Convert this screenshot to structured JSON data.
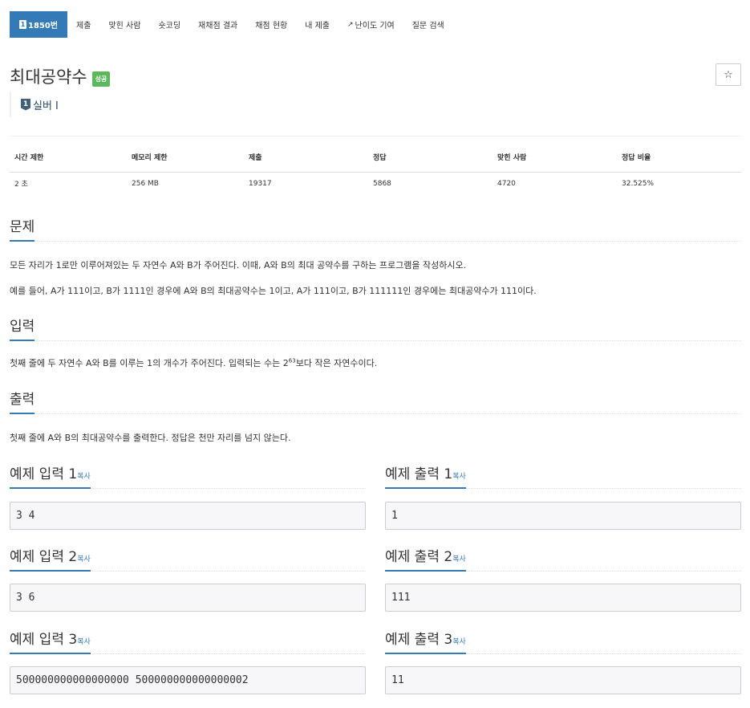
{
  "nav": {
    "problem_number": "1850번",
    "items": [
      "제출",
      "맞힌 사람",
      "숏코딩",
      "재채점 결과",
      "채점 현황",
      "내 제출",
      "난이도 기여",
      "질문 검색"
    ]
  },
  "problem": {
    "title": "최대공약수",
    "status_badge": "성공",
    "tier_label": "실버 I",
    "tier_number": "1",
    "star": "☆"
  },
  "info_table": {
    "headers": [
      "시간 제한",
      "메모리 제한",
      "제출",
      "정답",
      "맞힌 사람",
      "정답 비율"
    ],
    "values": [
      "2 초",
      "256 MB",
      "19317",
      "5868",
      "4720",
      "32.525%"
    ]
  },
  "sections": {
    "description_title": "문제",
    "description_p1": "모든 자리가 1로만 이루어져있는 두 자연수 A와 B가 주어진다. 이때, A와 B의 최대 공약수를 구하는 프로그램을 작성하시오.",
    "description_p2": "예를 들어, A가 111이고, B가 1111인 경우에 A와 B의 최대공약수는 1이고, A가 111이고, B가 111111인 경우에는 최대공약수가 111이다.",
    "input_title": "입력",
    "input_p_before": "첫째 줄에 두 자연수 A와 B를 이루는 1의 개수가 주어진다. 입력되는 수는 2",
    "input_p_sup": "63",
    "input_p_after": "보다 작은 자연수이다.",
    "output_title": "출력",
    "output_p": "첫째 줄에 A와 B의 최대공약수를 출력한다. 정답은 천만 자리를 넘지 않는다."
  },
  "copy_label": "복사",
  "samples": [
    {
      "input_title": "예제 입력 1",
      "output_title": "예제 출력 1",
      "input": "3 4",
      "output": "1"
    },
    {
      "input_title": "예제 입력 2",
      "output_title": "예제 출력 2",
      "input": "3 6",
      "output": "111"
    },
    {
      "input_title": "예제 입력 3",
      "output_title": "예제 출력 3",
      "input": "500000000000000000 500000000000000002",
      "output": "11"
    }
  ]
}
